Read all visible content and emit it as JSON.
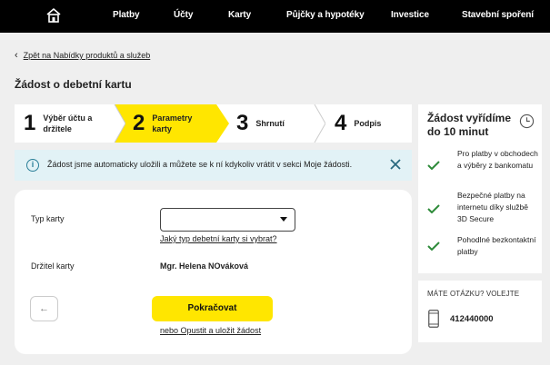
{
  "nav": {
    "items": [
      "Platby",
      "Účty",
      "Karty",
      "Půjčky a hypotéky",
      "Investice",
      "Stavební spoření"
    ]
  },
  "back_link": "Zpět na Nabídky produktů a služeb",
  "page_title": "Žádost o debetní kartu",
  "steps": [
    {
      "num": "1",
      "label_line1": "Výběr účtu a",
      "label_line2": "držitele",
      "active": false
    },
    {
      "num": "2",
      "label_line1": "Parametry",
      "label_line2": "karty",
      "active": true
    },
    {
      "num": "3",
      "label_line1": "Shrnutí",
      "label_line2": "",
      "active": false
    },
    {
      "num": "4",
      "label_line1": "Podpis",
      "label_line2": "",
      "active": false
    }
  ],
  "banner": {
    "text": "Žádost jsme automaticky uložili a můžete se k ní kdykoliv vrátit v sekci  Moje žádosti."
  },
  "form": {
    "card_type_label": "Typ karty",
    "card_type_value": "",
    "card_type_help": "Jaký typ debetní karty si vybrat?",
    "holder_label": "Držitel karty",
    "holder_value": "Mgr. Helena NOváková",
    "continue_label": "Pokračovat",
    "save_link": "nebo Opustit a uložit žádost"
  },
  "side": {
    "title": "Žádost vyřídíme do 10 minut",
    "features": [
      "Pro platby v obchodech a výběry z bankomatu",
      "Bezpečné platby na internetu díky službě 3D Secure",
      "Pohodlné bezkontaktní platby"
    ]
  },
  "contact": {
    "title": "MÁTE OTÁZKU? VOLEJTE",
    "phone": "412440000"
  },
  "colors": {
    "accent": "#ffe600",
    "nav_bg": "#000000",
    "check": "#2e8b3a",
    "info": "#2a7f98"
  }
}
